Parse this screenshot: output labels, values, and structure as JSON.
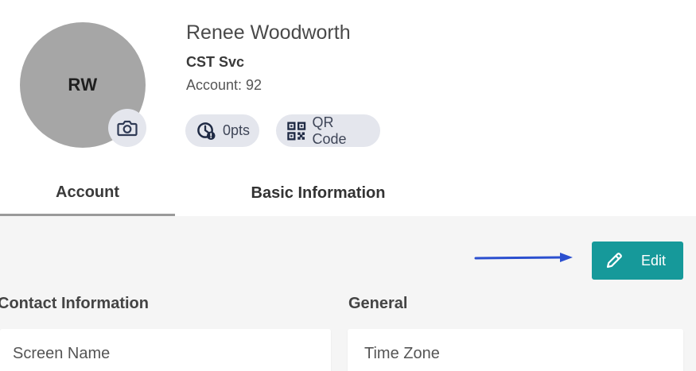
{
  "profile": {
    "initials": "RW",
    "name": "Renee Woodworth",
    "role": "CST Svc",
    "account": "Account: 92",
    "points_label": "0pts",
    "qr_label": "QR Code",
    "icons": {
      "camera": "camera-icon",
      "points": "clock-alert-icon",
      "qr": "qr-code-icon"
    }
  },
  "tabs": [
    {
      "label": "Account",
      "active": true
    },
    {
      "label": "Basic Information",
      "active": false
    }
  ],
  "toolbar": {
    "edit_label": "Edit",
    "edit_icon": "pencil-icon"
  },
  "sections": {
    "contact": {
      "title": "Contact Information",
      "fields": [
        "Screen Name"
      ]
    },
    "general": {
      "title": "General",
      "fields": [
        "Time Zone"
      ]
    }
  },
  "colors": {
    "accent": "#16999a",
    "annotation_arrow": "#2b4fcf",
    "avatar_bg": "#a6a6a6",
    "chip_bg": "#e4e6ed"
  }
}
